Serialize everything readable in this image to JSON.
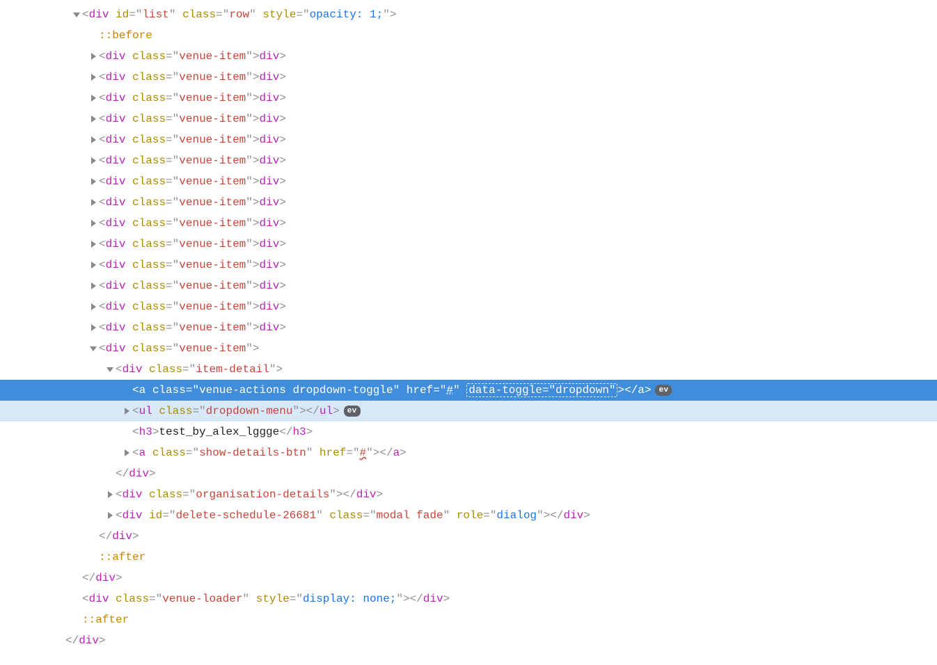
{
  "glyphs": {
    "ev": "ev"
  },
  "root": {
    "open_tag_parts": [
      "<",
      "div",
      " ",
      "id",
      "=",
      "\"",
      "list",
      "\"",
      " ",
      "class",
      "=",
      "\"",
      "row",
      "\"",
      " ",
      "style",
      "=",
      "\"",
      "opacity: 1;",
      "\"",
      ">"
    ]
  },
  "pseudo_before": "::before",
  "pseudo_after": "::after",
  "venue_item": {
    "open": [
      "<",
      "div",
      " ",
      "class",
      "=",
      "\"",
      "venue-item",
      "\"",
      ">"
    ],
    "close": [
      "</",
      "div",
      ">"
    ]
  },
  "item_detail_open": [
    "<",
    "div",
    " ",
    "class",
    "=",
    "\"",
    "item-detail",
    "\"",
    ">"
  ],
  "selected_line": {
    "parts_pre": [
      "<",
      "a",
      " ",
      "class",
      "=",
      "\"",
      "venue-actions dropdown-toggle",
      "\"",
      " ",
      "href",
      "=",
      "\""
    ],
    "hash": "#",
    "parts_mid": [
      "\"",
      " "
    ],
    "boxed": [
      "data-toggle",
      "=",
      "\"",
      "dropdown",
      "\""
    ],
    "parts_post": [
      ">",
      "</",
      "a",
      ">"
    ]
  },
  "dropdown_menu": [
    "<",
    "ul",
    " ",
    "class",
    "=",
    "\"",
    "dropdown-menu",
    "\"",
    ">",
    "</",
    "ul",
    ">"
  ],
  "h3_line": [
    "<",
    "h3",
    ">",
    "test_by_alex_lggge",
    "</",
    "h3",
    ">"
  ],
  "show_details": {
    "pre": [
      "<",
      "a",
      " ",
      "class",
      "=",
      "\"",
      "show-details-btn",
      "\"",
      " ",
      "href",
      "=",
      "\""
    ],
    "hash": "#",
    "post": [
      "\"",
      ">",
      "</",
      "a",
      ">"
    ]
  },
  "close_div": [
    "</",
    "div",
    ">"
  ],
  "org_details": [
    "<",
    "div",
    " ",
    "class",
    "=",
    "\"",
    "organisation-details",
    "\"",
    ">",
    "</",
    "div",
    ">"
  ],
  "delete_modal": [
    "<",
    "div",
    " ",
    "id",
    "=",
    "\"",
    "delete-schedule-26681",
    "\"",
    " ",
    "class",
    "=",
    "\"",
    "modal fade",
    "\"",
    " ",
    "role",
    "=",
    "\"",
    "dialog",
    "\"",
    ">",
    "</",
    "div",
    ">"
  ],
  "venue_loader": [
    "<",
    "div",
    " ",
    "class",
    "=",
    "\"",
    "venue-loader",
    "\"",
    " ",
    "style",
    "=",
    "\"",
    "display: none;",
    "\"",
    ">",
    "</",
    "div",
    ">"
  ],
  "collapsed_count": 14
}
